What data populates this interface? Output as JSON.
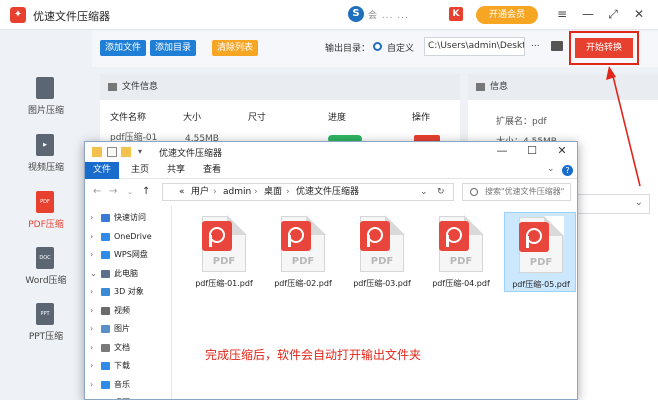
{
  "app": {
    "title": "优速文件压缩器",
    "logo_glyph": "✦",
    "promo_s": "S",
    "promo_text": "会 ...   ...",
    "promo_k": "K",
    "vip_label": "开通会员",
    "accent": "#e8402f"
  },
  "window_controls": {
    "menu": "≡",
    "minimize": "—",
    "maximize": "⤢",
    "close": "✕"
  },
  "sidebar": {
    "items": [
      {
        "label": "图片压缩",
        "icon": "image-icon",
        "glyph": ""
      },
      {
        "label": "视频压缩",
        "icon": "video-icon",
        "glyph": "▶"
      },
      {
        "label": "PDF压缩",
        "icon": "pdf-icon",
        "glyph": "PDF",
        "active": true
      },
      {
        "label": "Word压缩",
        "icon": "word-icon",
        "glyph": "DOC"
      },
      {
        "label": "PPT压缩",
        "icon": "ppt-icon",
        "glyph": "PPT"
      }
    ]
  },
  "toolbar": {
    "add_file": "添加文件",
    "add_dir": "添加目录",
    "clear_list": "清除列表",
    "output_label": "输出目录：",
    "radio_custom": "自定义",
    "output_path": "C:\\Users\\admin\\Deskto",
    "browse": "...",
    "start": "开始转换"
  },
  "file_panel": {
    "title": "文件信息",
    "columns": [
      "文件名称",
      "大小",
      "尺寸",
      "进度",
      "操作"
    ],
    "row": {
      "name": "pdf压缩-01",
      "size": "4.55MB"
    }
  },
  "info_panel": {
    "title": "信息",
    "ext_label": "扩展名：pdf",
    "size_label": "大小：4.55MB"
  },
  "explorer": {
    "title": "优速文件压缩器",
    "ribbon_tabs": [
      "文件",
      "主页",
      "共享",
      "查看"
    ],
    "crumbs": [
      "«",
      "用户",
      "›",
      "admin",
      "›",
      "桌面",
      "›",
      "优速文件压缩器"
    ],
    "search_placeholder": "搜索\"优速文件压缩器\"",
    "tree": [
      {
        "label": "快速访问",
        "chev": "›",
        "color": "#3a7bd5",
        "icon": "star-icon"
      },
      {
        "label": "OneDrive",
        "chev": "›",
        "color": "#2f8ae8",
        "icon": "cloud-icon"
      },
      {
        "label": "WPS网盘",
        "chev": "›",
        "color": "#2f8ae8",
        "icon": "cloud-icon"
      },
      {
        "label": "此电脑",
        "chev": "⌄",
        "color": "#5b6f8a",
        "icon": "computer-icon"
      },
      {
        "label": "3D 对象",
        "chev": "›",
        "color": "#3a8ad6",
        "icon": "cube-icon"
      },
      {
        "label": "视频",
        "chev": "›",
        "color": "#6b6b6b",
        "icon": "film-icon"
      },
      {
        "label": "图片",
        "chev": "›",
        "color": "#5b8fc7",
        "icon": "picture-icon"
      },
      {
        "label": "文档",
        "chev": "›",
        "color": "#7a7a7a",
        "icon": "document-icon"
      },
      {
        "label": "下载",
        "chev": "›",
        "color": "#2f8ae8",
        "icon": "download-icon"
      },
      {
        "label": "音乐",
        "chev": "›",
        "color": "#2f8ae8",
        "icon": "music-icon"
      },
      {
        "label": "桌面",
        "chev": "›",
        "color": "#3a7bd5",
        "icon": "desktop-icon"
      }
    ],
    "files": [
      {
        "name": "pdf压缩-01.pdf",
        "selected": false
      },
      {
        "name": "pdf压缩-02.pdf",
        "selected": false
      },
      {
        "name": "pdf压缩-03.pdf",
        "selected": false
      },
      {
        "name": "pdf压缩-04.pdf",
        "selected": false
      },
      {
        "name": "pdf压缩-05.pdf",
        "selected": true
      }
    ],
    "file_badge_text": "PDF"
  },
  "callout": "完成压缩后，软件会自动打开输出文件夹"
}
